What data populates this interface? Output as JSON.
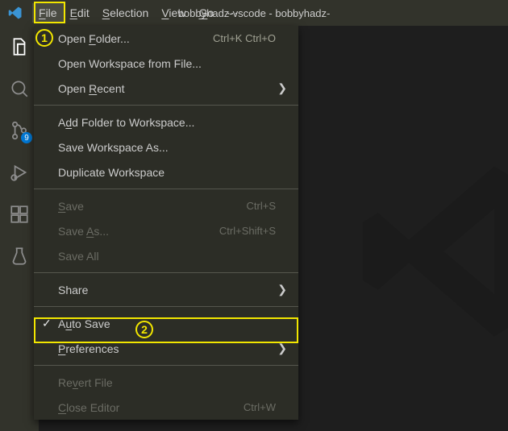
{
  "title": "bobbyhadz-vscode - bobbyhadz-",
  "menubar": {
    "file": "File",
    "edit": "Edit",
    "selection": "Selection",
    "view": "View",
    "go": "Go",
    "overflow": "⋯"
  },
  "scm_badge": "9",
  "file_menu": {
    "open_folder": {
      "label": "Open Folder...",
      "shortcut": "Ctrl+K Ctrl+O"
    },
    "open_workspace": {
      "label": "Open Workspace from File..."
    },
    "open_recent": {
      "label": "Open Recent"
    },
    "add_folder": {
      "label": "Add Folder to Workspace..."
    },
    "save_workspace_as": {
      "label": "Save Workspace As..."
    },
    "duplicate_workspace": {
      "label": "Duplicate Workspace"
    },
    "save": {
      "label": "Save",
      "shortcut": "Ctrl+S"
    },
    "save_as": {
      "label": "Save As...",
      "shortcut": "Ctrl+Shift+S"
    },
    "save_all": {
      "label": "Save All"
    },
    "share": {
      "label": "Share"
    },
    "auto_save": {
      "label": "Auto Save"
    },
    "preferences": {
      "label": "Preferences"
    },
    "revert_file": {
      "label": "Revert File"
    },
    "close_editor": {
      "label": "Close Editor",
      "shortcut": "Ctrl+W"
    }
  },
  "annotations": {
    "one": "1",
    "two": "2"
  }
}
